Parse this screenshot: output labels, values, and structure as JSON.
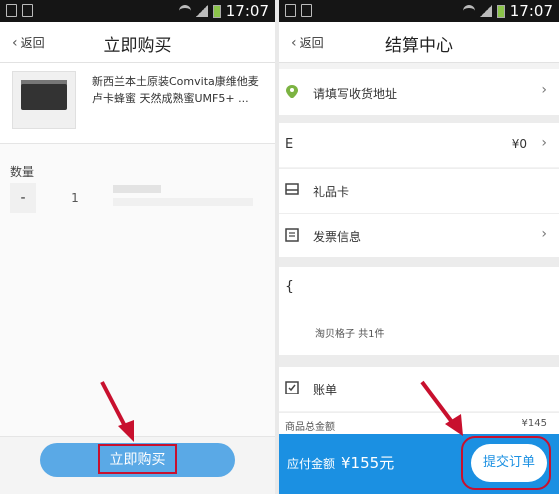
{
  "status": {
    "time": "17:07"
  },
  "left": {
    "back": "返回",
    "title": "立即购买",
    "product_name": "新西兰本土原装Comvita康维他麦卢卡蜂蜜 天然成熟蜜UMF5+ ...",
    "qty_label": "数量",
    "qty_minus": "-",
    "qty_value": "1",
    "buy_button": "立即购买"
  },
  "right": {
    "back": "返回",
    "title": "结算中心",
    "address": "请填写收货地址",
    "coupon_partial": "E",
    "coupon_value": "¥0",
    "gift_card": "礼品卡",
    "invoice": "发票信息",
    "store_partial": "{",
    "shop_line": "淘贝格子 共1件",
    "bill": "账单",
    "goods_total_label": "商品总金额",
    "goods_total_value": "¥145",
    "due_label": "应付金额",
    "due_value": "¥155元",
    "submit": "提交订单"
  },
  "colors": {
    "accent": "#1b90e2",
    "highlight": "#c8102e",
    "location": "#7cb342"
  }
}
